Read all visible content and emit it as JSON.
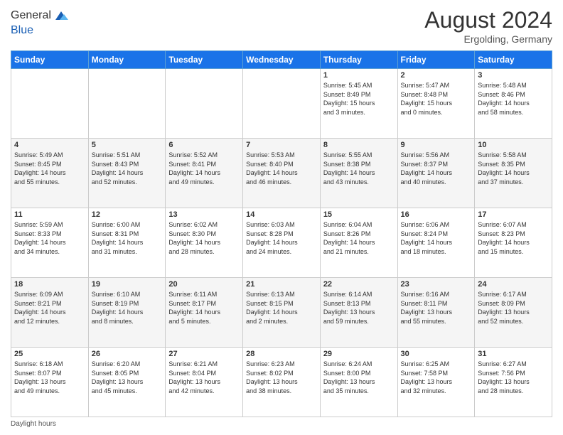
{
  "header": {
    "logo_line1": "General",
    "logo_line2": "Blue",
    "month_year": "August 2024",
    "location": "Ergolding, Germany"
  },
  "days_of_week": [
    "Sunday",
    "Monday",
    "Tuesday",
    "Wednesday",
    "Thursday",
    "Friday",
    "Saturday"
  ],
  "weeks": [
    [
      {
        "day": "",
        "info": ""
      },
      {
        "day": "",
        "info": ""
      },
      {
        "day": "",
        "info": ""
      },
      {
        "day": "",
        "info": ""
      },
      {
        "day": "1",
        "info": "Sunrise: 5:45 AM\nSunset: 8:49 PM\nDaylight: 15 hours\nand 3 minutes."
      },
      {
        "day": "2",
        "info": "Sunrise: 5:47 AM\nSunset: 8:48 PM\nDaylight: 15 hours\nand 0 minutes."
      },
      {
        "day": "3",
        "info": "Sunrise: 5:48 AM\nSunset: 8:46 PM\nDaylight: 14 hours\nand 58 minutes."
      }
    ],
    [
      {
        "day": "4",
        "info": "Sunrise: 5:49 AM\nSunset: 8:45 PM\nDaylight: 14 hours\nand 55 minutes."
      },
      {
        "day": "5",
        "info": "Sunrise: 5:51 AM\nSunset: 8:43 PM\nDaylight: 14 hours\nand 52 minutes."
      },
      {
        "day": "6",
        "info": "Sunrise: 5:52 AM\nSunset: 8:41 PM\nDaylight: 14 hours\nand 49 minutes."
      },
      {
        "day": "7",
        "info": "Sunrise: 5:53 AM\nSunset: 8:40 PM\nDaylight: 14 hours\nand 46 minutes."
      },
      {
        "day": "8",
        "info": "Sunrise: 5:55 AM\nSunset: 8:38 PM\nDaylight: 14 hours\nand 43 minutes."
      },
      {
        "day": "9",
        "info": "Sunrise: 5:56 AM\nSunset: 8:37 PM\nDaylight: 14 hours\nand 40 minutes."
      },
      {
        "day": "10",
        "info": "Sunrise: 5:58 AM\nSunset: 8:35 PM\nDaylight: 14 hours\nand 37 minutes."
      }
    ],
    [
      {
        "day": "11",
        "info": "Sunrise: 5:59 AM\nSunset: 8:33 PM\nDaylight: 14 hours\nand 34 minutes."
      },
      {
        "day": "12",
        "info": "Sunrise: 6:00 AM\nSunset: 8:31 PM\nDaylight: 14 hours\nand 31 minutes."
      },
      {
        "day": "13",
        "info": "Sunrise: 6:02 AM\nSunset: 8:30 PM\nDaylight: 14 hours\nand 28 minutes."
      },
      {
        "day": "14",
        "info": "Sunrise: 6:03 AM\nSunset: 8:28 PM\nDaylight: 14 hours\nand 24 minutes."
      },
      {
        "day": "15",
        "info": "Sunrise: 6:04 AM\nSunset: 8:26 PM\nDaylight: 14 hours\nand 21 minutes."
      },
      {
        "day": "16",
        "info": "Sunrise: 6:06 AM\nSunset: 8:24 PM\nDaylight: 14 hours\nand 18 minutes."
      },
      {
        "day": "17",
        "info": "Sunrise: 6:07 AM\nSunset: 8:23 PM\nDaylight: 14 hours\nand 15 minutes."
      }
    ],
    [
      {
        "day": "18",
        "info": "Sunrise: 6:09 AM\nSunset: 8:21 PM\nDaylight: 14 hours\nand 12 minutes."
      },
      {
        "day": "19",
        "info": "Sunrise: 6:10 AM\nSunset: 8:19 PM\nDaylight: 14 hours\nand 8 minutes."
      },
      {
        "day": "20",
        "info": "Sunrise: 6:11 AM\nSunset: 8:17 PM\nDaylight: 14 hours\nand 5 minutes."
      },
      {
        "day": "21",
        "info": "Sunrise: 6:13 AM\nSunset: 8:15 PM\nDaylight: 14 hours\nand 2 minutes."
      },
      {
        "day": "22",
        "info": "Sunrise: 6:14 AM\nSunset: 8:13 PM\nDaylight: 13 hours\nand 59 minutes."
      },
      {
        "day": "23",
        "info": "Sunrise: 6:16 AM\nSunset: 8:11 PM\nDaylight: 13 hours\nand 55 minutes."
      },
      {
        "day": "24",
        "info": "Sunrise: 6:17 AM\nSunset: 8:09 PM\nDaylight: 13 hours\nand 52 minutes."
      }
    ],
    [
      {
        "day": "25",
        "info": "Sunrise: 6:18 AM\nSunset: 8:07 PM\nDaylight: 13 hours\nand 49 minutes."
      },
      {
        "day": "26",
        "info": "Sunrise: 6:20 AM\nSunset: 8:05 PM\nDaylight: 13 hours\nand 45 minutes."
      },
      {
        "day": "27",
        "info": "Sunrise: 6:21 AM\nSunset: 8:04 PM\nDaylight: 13 hours\nand 42 minutes."
      },
      {
        "day": "28",
        "info": "Sunrise: 6:23 AM\nSunset: 8:02 PM\nDaylight: 13 hours\nand 38 minutes."
      },
      {
        "day": "29",
        "info": "Sunrise: 6:24 AM\nSunset: 8:00 PM\nDaylight: 13 hours\nand 35 minutes."
      },
      {
        "day": "30",
        "info": "Sunrise: 6:25 AM\nSunset: 7:58 PM\nDaylight: 13 hours\nand 32 minutes."
      },
      {
        "day": "31",
        "info": "Sunrise: 6:27 AM\nSunset: 7:56 PM\nDaylight: 13 hours\nand 28 minutes."
      }
    ]
  ],
  "footer": {
    "daylight_label": "Daylight hours"
  }
}
